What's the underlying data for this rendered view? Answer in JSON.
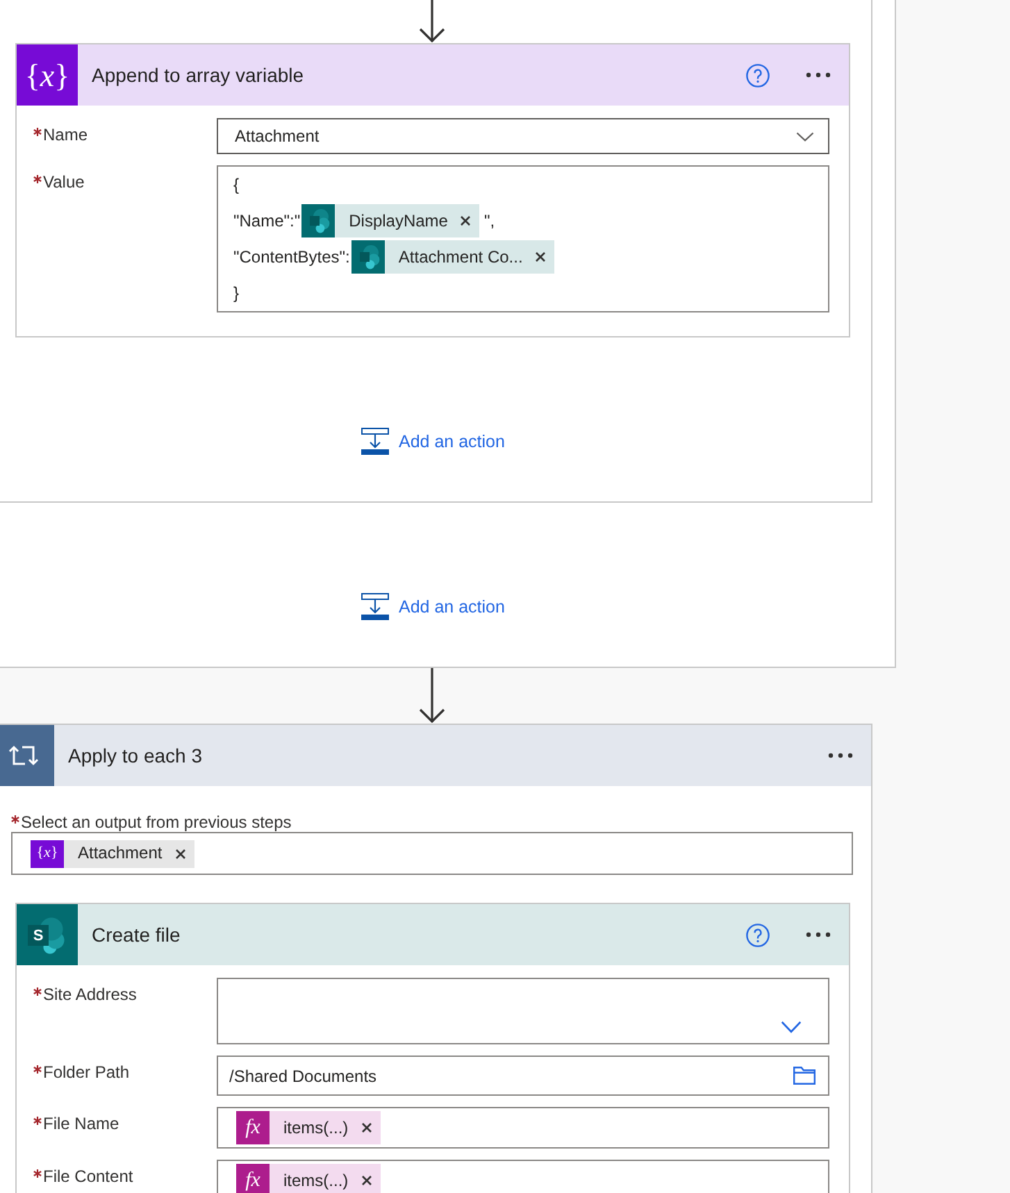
{
  "scope": {
    "inner_scope": {
      "card": {
        "kind": "variable",
        "icon": "{*x*}",
        "title": "Append to array variable",
        "help": true,
        "fields": [
          {
            "label": "Name",
            "required": true,
            "kind": "dropdown",
            "value": "Attachment"
          },
          {
            "label": "Value",
            "required": true,
            "kind": "code",
            "lines": [
              [
                {
                  "kind": "text",
                  "text": "{"
                }
              ],
              [
                {
                  "kind": "text",
                  "text": "\"Name\":\""
                },
                {
                  "kind": "token",
                  "token": {
                    "kind": "sharepoint",
                    "label": "DisplayName"
                  }
                },
                {
                  "kind": "text",
                  "text": "\","
                }
              ],
              [
                {
                  "kind": "text",
                  "text": "\"ContentBytes\":"
                },
                {
                  "kind": "token",
                  "token": {
                    "kind": "sharepoint",
                    "label": "Attachment Co..."
                  }
                }
              ],
              [
                {
                  "kind": "text",
                  "text": "}"
                }
              ]
            ]
          }
        ]
      },
      "add_action": "Add an action"
    },
    "add_action": "Add an action"
  },
  "loop": {
    "kind": "foreach",
    "title": "Apply to each 3",
    "output": {
      "label": "Select an output from previous steps",
      "required": true,
      "tokens": [
        {
          "kind": "variable",
          "icon": "{*x*}",
          "label": "Attachment"
        }
      ]
    },
    "card": {
      "kind": "sharepoint",
      "icon": "S",
      "title": "Create file",
      "help": true,
      "fields": [
        {
          "label": "Site Address",
          "required": true,
          "kind": "site"
        },
        {
          "label": "Folder Path",
          "required": true,
          "kind": "folder",
          "value": "/Shared Documents"
        },
        {
          "label": "File Name",
          "required": true,
          "kind": "tokens",
          "tokens": [
            {
              "kind": "expression",
              "icon": "fx",
              "label": "items(...)"
            }
          ]
        },
        {
          "label": "File Content",
          "required": true,
          "kind": "tokens",
          "tokens": [
            {
              "kind": "expression",
              "icon": "fx",
              "label": "items(...)"
            }
          ]
        }
      ]
    }
  }
}
